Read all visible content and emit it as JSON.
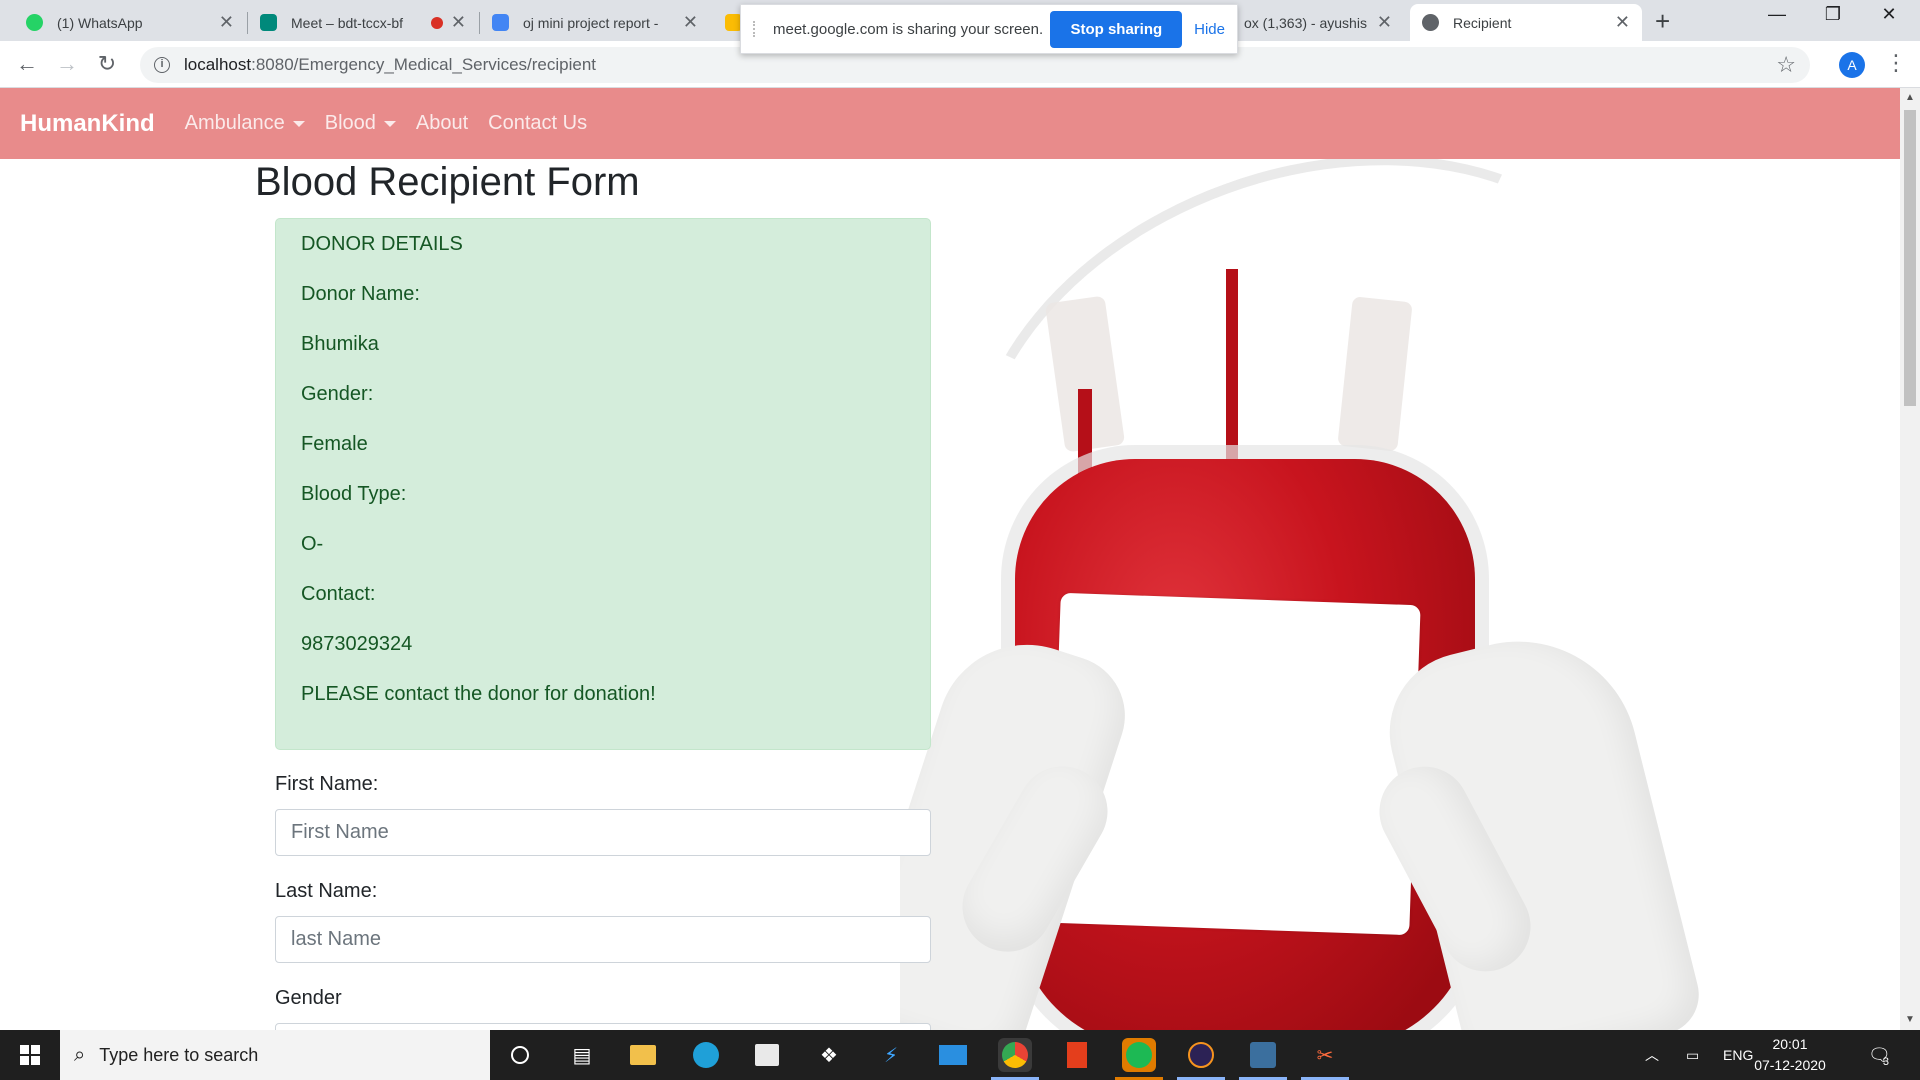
{
  "browser": {
    "tabs": [
      {
        "title": "(1) WhatsApp",
        "favicon_color": "#25d366"
      },
      {
        "title": "Meet – bdt-tccx-bf",
        "favicon_color": "#00897b"
      },
      {
        "title": "oj mini project report -",
        "favicon_color": "#4285f4"
      },
      {
        "title": "",
        "favicon_color": "#fbbc04"
      },
      {
        "title": "ox (1,363) - ayushis",
        "favicon_color": "#ea4335"
      },
      {
        "title": "Recipient",
        "favicon_color": "#5f6368"
      }
    ],
    "active_tab_index": 5,
    "url_host": "localhost",
    "url_rest": ":8080/Emergency_Medical_Services/recipient",
    "profile_initial": "A"
  },
  "screen_share": {
    "message": "meet.google.com is sharing your screen.",
    "stop_label": "Stop sharing",
    "hide_label": "Hide"
  },
  "navbar": {
    "brand": "HumanKind",
    "links": [
      {
        "label": "Ambulance",
        "dropdown": true
      },
      {
        "label": "Blood",
        "dropdown": true
      },
      {
        "label": "About",
        "dropdown": false
      },
      {
        "label": "Contact Us",
        "dropdown": false
      }
    ],
    "bg_color": "#e88b8b"
  },
  "page": {
    "title": "Blood Recipient Form",
    "donor_box": {
      "heading": "DONOR DETAILS",
      "name_label": "Donor Name:",
      "name_value": "Bhumika",
      "gender_label": "Gender:",
      "gender_value": "Female",
      "blood_label": "Blood Type:",
      "blood_value": "O-",
      "contact_label": "Contact:",
      "contact_value": "9873029324",
      "note": "PLEASE contact the donor for donation!",
      "bg_color": "#d4eddb",
      "text_color": "#155724"
    },
    "form": {
      "first_name_label": "First Name:",
      "first_name_placeholder": "First Name",
      "last_name_label": "Last Name:",
      "last_name_placeholder": "last Name",
      "gender_label": "Gender"
    }
  },
  "taskbar": {
    "search_placeholder": "Type here to search",
    "language": "ENG",
    "time": "20:01",
    "date": "07-12-2020",
    "notification_count": "3",
    "apps": [
      "cortana-icon",
      "task-view-icon",
      "file-explorer-icon",
      "edge-icon",
      "store-icon",
      "dropbox-icon",
      "vscode-icon",
      "mail-icon",
      "chrome-icon",
      "office-icon",
      "spotify-icon",
      "eclipse-icon",
      "mysql-icon",
      "snip-icon"
    ]
  }
}
